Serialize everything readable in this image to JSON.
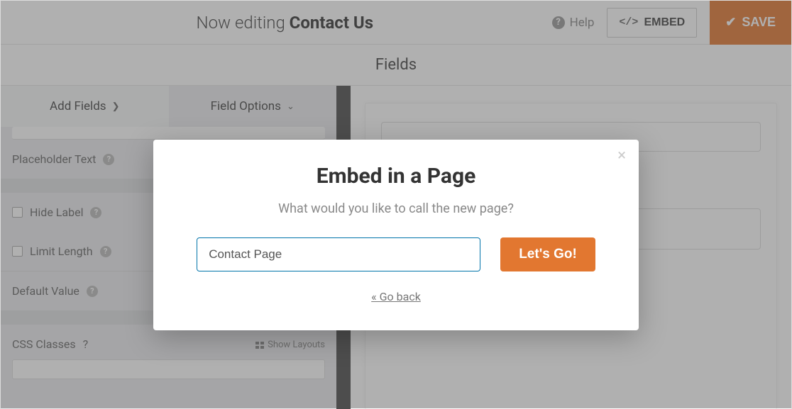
{
  "topbar": {
    "editing_prefix": "Now editing",
    "form_name": "Contact Us",
    "help_label": "Help",
    "embed_label": "EMBED",
    "save_label": "SAVE"
  },
  "fields_header": "Fields",
  "tabs": {
    "add_fields": "Add Fields",
    "field_options": "Field Options"
  },
  "options": {
    "placeholder_text": "Placeholder Text",
    "hide_label": "Hide Label",
    "limit_length": "Limit Length",
    "default_value": "Default Value",
    "css_classes": "CSS Classes",
    "show_layouts": "Show Layouts"
  },
  "modal": {
    "title": "Embed in a Page",
    "subtitle": "What would you like to call the new page?",
    "input_value": "Contact Page",
    "go_label": "Let's Go!",
    "back_label": "« Go back"
  }
}
